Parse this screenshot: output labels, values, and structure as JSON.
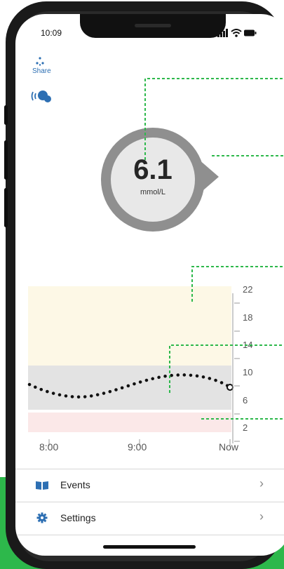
{
  "status": {
    "time": "10:09"
  },
  "toolbar": {
    "share_label": "Share"
  },
  "reading": {
    "value": "6.1",
    "unit": "mmol/L"
  },
  "graph": {
    "y_ticks": [
      "22",
      "18",
      "14",
      "10",
      "6",
      "2"
    ],
    "x_labels": [
      "8:00",
      "9:00",
      "Now"
    ]
  },
  "menu": {
    "events_label": "Events",
    "settings_label": "Settings"
  },
  "colors": {
    "high_band": "#fdf8e6",
    "target_band": "#e3e3e3",
    "low_band": "#fbe8e8",
    "annotation": "#2db84b",
    "accent": "#2d6fb3"
  }
}
